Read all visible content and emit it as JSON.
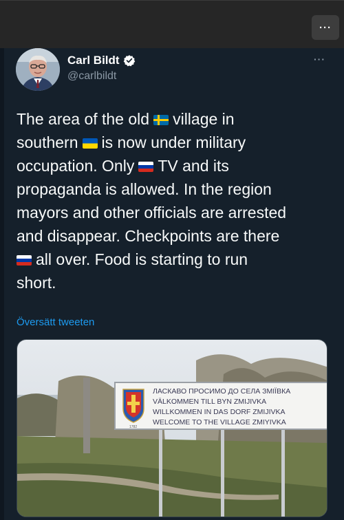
{
  "topbar": {
    "more_label": "···"
  },
  "author": {
    "name": "Carl Bildt",
    "handle": "@carlbildt"
  },
  "tweet": {
    "line1_a": "The area of the old",
    "line1_b": "village in",
    "line2_a": "southern",
    "line2_b": "is now under military",
    "line3_a": "occupation. Only",
    "line3_b": "TV and its",
    "line4": "propaganda is allowed. In the region",
    "line5": "mayors and other officials are arrested",
    "line6": "and disappear. Checkpoints  are there",
    "line7_b": "all over. Food is starting to run",
    "line8": "short."
  },
  "translate_label": "Översätt tweeten",
  "more_label": "···",
  "media": {
    "sign_line1": "ЛАСКАВО ПРОСИМО ДО СЕЛА ЗМІЇВКА",
    "sign_line2": "VÄLKOMMEN TILL BYN ZMIJIVKA",
    "sign_line3": "WILLKOMMEN IN DAS DORF ZMIJIVKA",
    "sign_line4": "WELCOME TO THE VILLAGE ZMIYIVKA",
    "crest_year": "1782"
  },
  "flags": {
    "sweden": "sweden-flag-icon",
    "ukraine": "ukraine-flag-icon",
    "russia": "russia-flag-icon"
  },
  "colors": {
    "background": "#15202b",
    "link": "#1d9bf0",
    "secondary_text": "#8b98a5"
  }
}
